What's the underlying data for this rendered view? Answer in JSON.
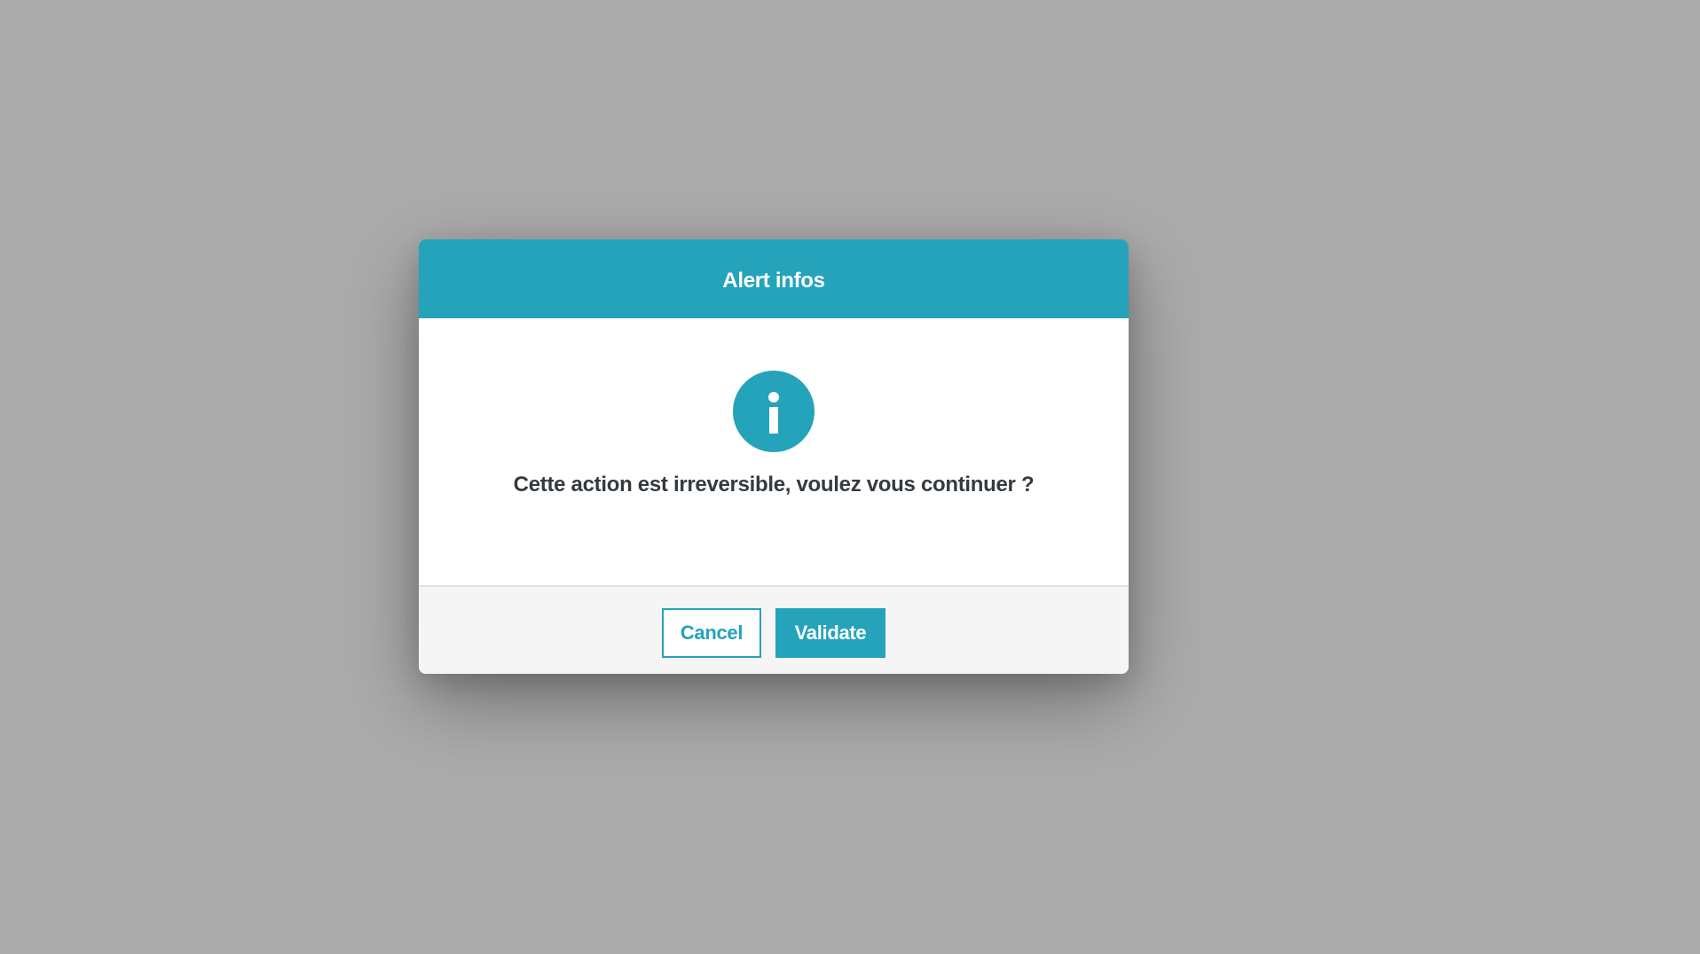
{
  "dialog": {
    "title": "Alert infos",
    "icon": "info-icon",
    "message": "Cette action est irreversible, voulez vous continuer ?",
    "cancel_label": "Cancel",
    "validate_label": "Validate"
  },
  "colors": {
    "accent": "#25a3ba",
    "backdrop": "#acacac",
    "footer_bg": "#f5f5f5",
    "message_text": "#343a40"
  }
}
